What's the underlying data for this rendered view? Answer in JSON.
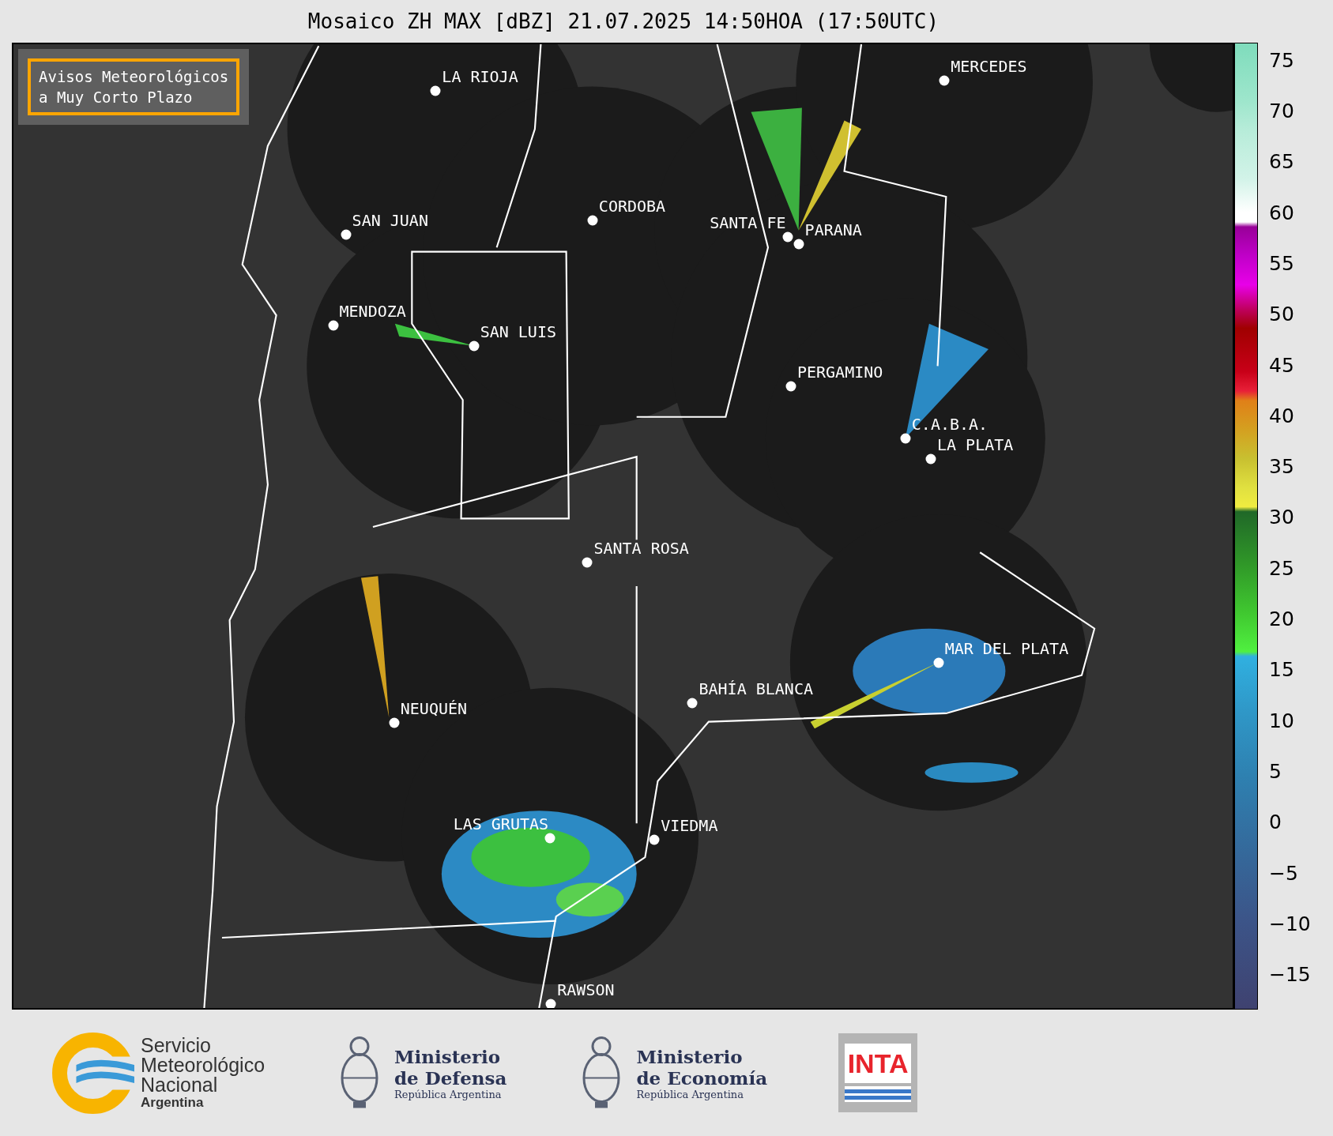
{
  "title": "Mosaico ZH MAX [dBZ] 21.07.2025 14:50HOA (17:50UTC)",
  "notice": {
    "lines": [
      "Avisos Meteorológicos",
      "a Muy Corto Plazo"
    ]
  },
  "cities": [
    {
      "name": "MERCEDES"
    },
    {
      "name": "LA RIOJA"
    },
    {
      "name": "CORDOBA"
    },
    {
      "name": "SAN JUAN"
    },
    {
      "name": "SANTA FE"
    },
    {
      "name": "PARANA"
    },
    {
      "name": "MENDOZA"
    },
    {
      "name": "SAN LUIS"
    },
    {
      "name": "PERGAMINO"
    },
    {
      "name": "C.A.B.A."
    },
    {
      "name": "LA PLATA"
    },
    {
      "name": "SANTA ROSA"
    },
    {
      "name": "MAR DEL PLATA"
    },
    {
      "name": "BAHÍA BLANCA"
    },
    {
      "name": "NEUQUÉN"
    },
    {
      "name": "LAS GRUTAS"
    },
    {
      "name": "VIEDMA"
    },
    {
      "name": "RAWSON"
    }
  ],
  "colorbar": {
    "ticks": [
      "75",
      "70",
      "65",
      "60",
      "55",
      "50",
      "45",
      "40",
      "35",
      "30",
      "25",
      "20",
      "15",
      "10",
      "5",
      "0",
      "−5",
      "−10",
      "−15"
    ]
  },
  "footer": {
    "logos": [
      {
        "kind": "smn",
        "lines": [
          "Servicio",
          "Meteorológico",
          "Nacional"
        ],
        "subtitle": "Argentina"
      },
      {
        "kind": "ministry",
        "lines": [
          "Ministerio",
          "de Defensa"
        ],
        "subtitle": "República Argentina"
      },
      {
        "kind": "ministry",
        "lines": [
          "Ministerio",
          "de Economía"
        ],
        "subtitle": "República Argentina"
      },
      {
        "kind": "inta",
        "text": "INTA"
      }
    ]
  }
}
